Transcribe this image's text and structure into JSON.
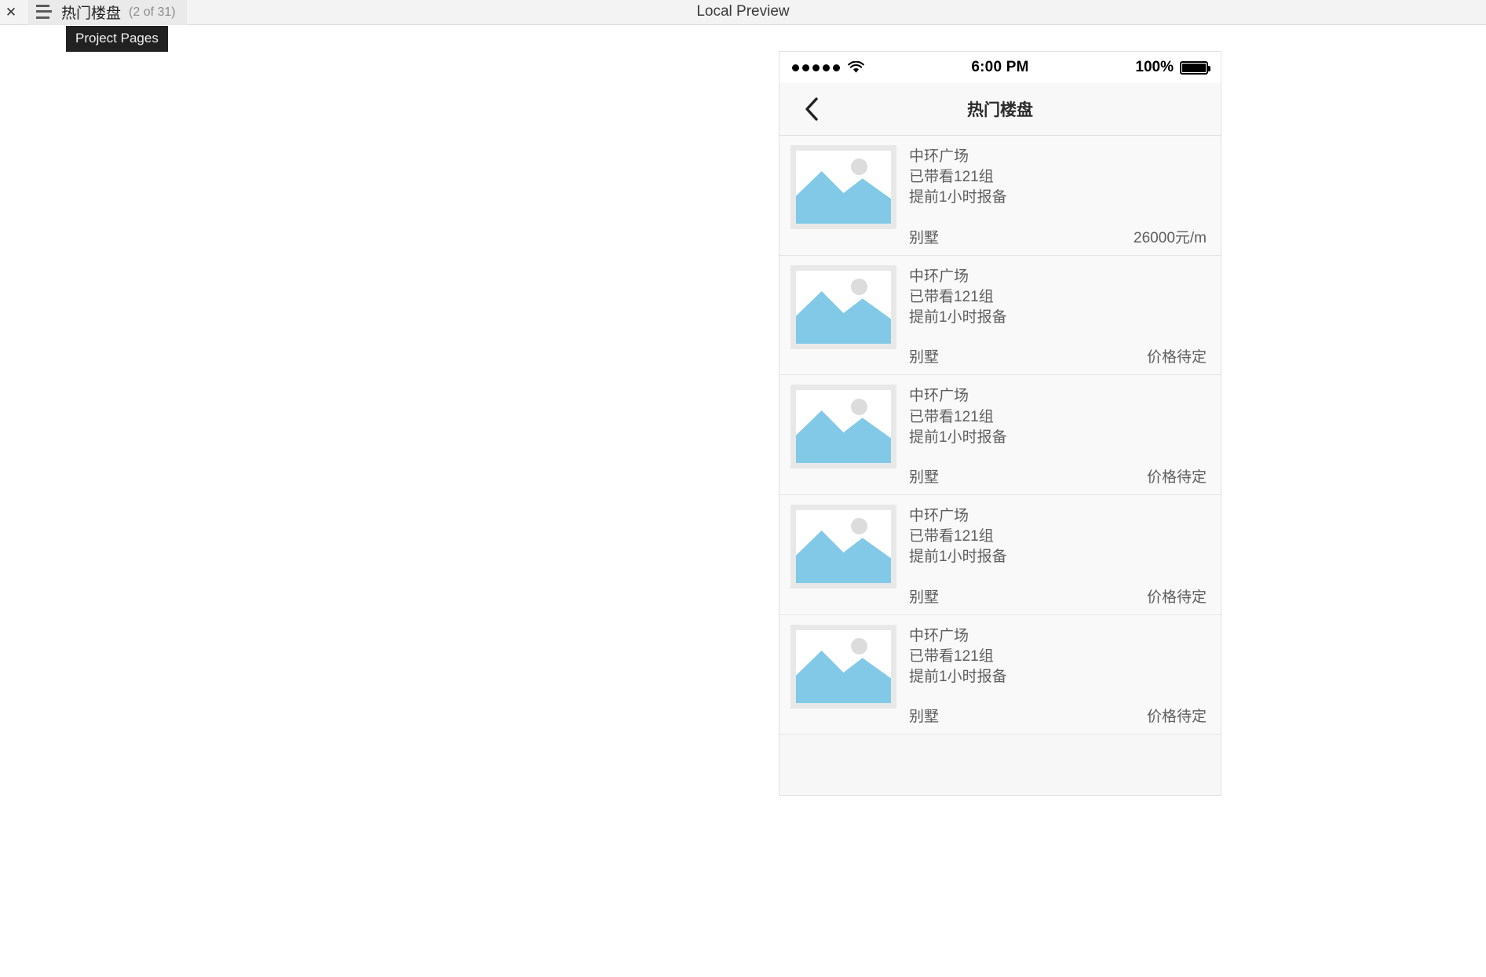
{
  "app_bar": {
    "close_icon": "close-icon",
    "menu_icon": "hamburger-menu-icon",
    "tab_title": "热门楼盘",
    "tab_counter": "(2 of 31)",
    "preview_label": "Local Preview"
  },
  "tooltip": {
    "text": "Project Pages"
  },
  "phone": {
    "status_bar": {
      "signal_icon": "signal-dots-icon",
      "wifi_icon": "wifi-icon",
      "time": "6:00 PM",
      "battery_percent": "100%",
      "battery_icon": "battery-full-icon"
    },
    "nav_bar": {
      "back_icon": "back-chevron-icon",
      "title": "热门楼盘"
    },
    "listings": [
      {
        "thumb_icon": "image-placeholder-icon",
        "name": "中环广场",
        "visits": "已带看121组",
        "notice": "提前1小时报备",
        "type": "别墅",
        "price": "26000元/m"
      },
      {
        "thumb_icon": "image-placeholder-icon",
        "name": "中环广场",
        "visits": "已带看121组",
        "notice": "提前1小时报备",
        "type": "别墅",
        "price": "价格待定"
      },
      {
        "thumb_icon": "image-placeholder-icon",
        "name": "中环广场",
        "visits": "已带看121组",
        "notice": "提前1小时报备",
        "type": "别墅",
        "price": "价格待定"
      },
      {
        "thumb_icon": "image-placeholder-icon",
        "name": "中环广场",
        "visits": "已带看121组",
        "notice": "提前1小时报备",
        "type": "别墅",
        "price": "价格待定"
      },
      {
        "thumb_icon": "image-placeholder-icon",
        "name": "中环广场",
        "visits": "已带看121组",
        "notice": "提前1小时报备",
        "type": "别墅",
        "price": "价格待定"
      }
    ]
  },
  "colors": {
    "thumb_blue": "#82c9e8",
    "thumb_frame": "#e8e8e8",
    "panel_bg": "#f9f9f9",
    "tooltip_bg": "#212121",
    "appbar_bg": "#f3f3f3"
  }
}
